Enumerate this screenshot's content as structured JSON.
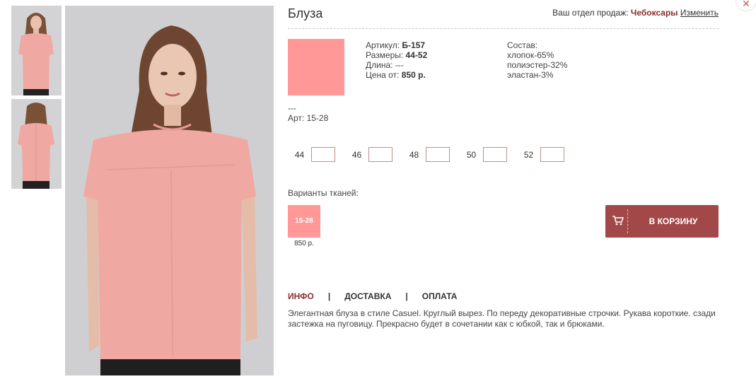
{
  "close": {
    "icon": "close-icon",
    "glyph": "✕"
  },
  "product": {
    "title": "Блуза",
    "swatch_color": "#ff9896",
    "specs": {
      "article_label": "Артикул:",
      "article": "Б-157",
      "sizes_label": "Размеры:",
      "sizes": "44-52",
      "length_label": "Длина:",
      "length": "---",
      "price_label": "Цена от:",
      "price": "850 р."
    },
    "composition": {
      "label": "Состав:",
      "items": [
        "хлопок-65%",
        "полиэстер-32%",
        "эластан-3%"
      ]
    },
    "variant_name": "---",
    "variant_art": "Арт: 15-28"
  },
  "region": {
    "label": "Ваш отдел продаж:",
    "city": "Чебоксары",
    "change": "Изменить"
  },
  "sizes": [
    {
      "label": "44",
      "value": ""
    },
    {
      "label": "46",
      "value": ""
    },
    {
      "label": "48",
      "value": ""
    },
    {
      "label": "50",
      "value": ""
    },
    {
      "label": "52",
      "value": ""
    }
  ],
  "fabrics": {
    "title": "Варианты тканей:",
    "items": [
      {
        "code": "15-28",
        "price": "850 р.",
        "color": "#ff9896"
      }
    ]
  },
  "cart": {
    "label": "В КОРЗИНУ",
    "icon": "cart-icon",
    "color": "#a24848"
  },
  "tabs": [
    {
      "label": "ИНФО",
      "active": true
    },
    {
      "label": "ДОСТАВКА",
      "active": false
    },
    {
      "label": "ОПЛАТА",
      "active": false
    }
  ],
  "tab_separator": "|",
  "description": "Элегантная блуза в стиле Casuel. Круглый вырез. По переду декоративные строчки. Рукава короткие. сзади застежка на пуговицу. Прекрасно будет в сочетании как с юбкой, так и брюками.",
  "colors": {
    "accent": "#8b2d2d",
    "button": "#a24848",
    "blouse": "#f0a8a2"
  }
}
